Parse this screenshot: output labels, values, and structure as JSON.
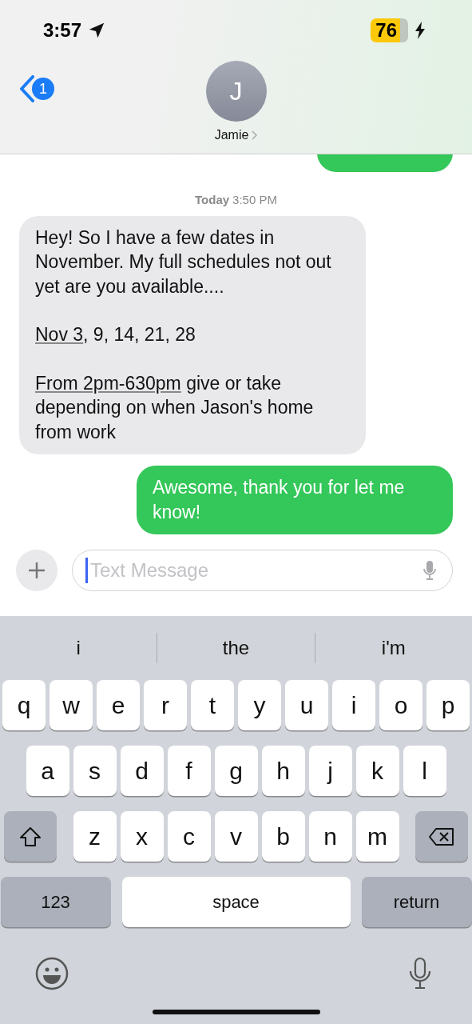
{
  "status_bar": {
    "time": "3:57",
    "battery": "76"
  },
  "header": {
    "back_badge": "1",
    "avatar_initial": "J",
    "contact_name": "Jamie"
  },
  "messages": [
    {
      "kind": "sent_partial"
    },
    {
      "kind": "timestamp",
      "day": "Today",
      "time": "3:50 PM"
    },
    {
      "kind": "received",
      "paragraphs": [
        [
          {
            "text": "Hey! So I have a few dates in November. My full schedules not out yet are you available....",
            "link": false
          }
        ],
        [
          {
            "text": "Nov 3",
            "link": true
          },
          {
            "text": ", 9, 14, 21, 28",
            "link": false
          }
        ],
        [
          {
            "text": "From 2pm-630pm",
            "link": true
          },
          {
            "text": " give or take depending on when Jason's home from work",
            "link": false
          }
        ]
      ]
    },
    {
      "kind": "sent",
      "paragraphs": [
        [
          {
            "text": "Awesome, thank you for let me know!",
            "link": false
          }
        ]
      ]
    }
  ],
  "composer": {
    "placeholder": "Text Message"
  },
  "suggestions": [
    "i",
    "the",
    "i'm"
  ],
  "keyboard": {
    "rows": [
      [
        "q",
        "w",
        "e",
        "r",
        "t",
        "y",
        "u",
        "i",
        "o",
        "p"
      ],
      [
        "a",
        "s",
        "d",
        "f",
        "g",
        "h",
        "j",
        "k",
        "l"
      ],
      [
        "z",
        "x",
        "c",
        "v",
        "b",
        "n",
        "m"
      ]
    ],
    "numbers_key": "123",
    "space_key": "space",
    "return_key": "return"
  }
}
